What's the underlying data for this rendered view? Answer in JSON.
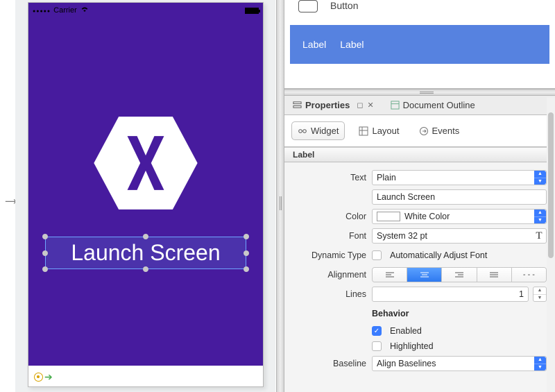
{
  "canvas": {
    "statusbar_carrier": "Carrier",
    "label_text": "Launch Screen"
  },
  "toolbox": {
    "button_label": "Button",
    "label1": "Label",
    "label2": "Label"
  },
  "panel_tabs": {
    "properties": "Properties",
    "outline": "Document Outline"
  },
  "widget_tabs": {
    "widget": "Widget",
    "layout": "Layout",
    "events": "Events"
  },
  "section": {
    "label_header": "Label"
  },
  "form": {
    "text_label": "Text",
    "text_type": "Plain",
    "text_value": "Launch Screen",
    "color_label": "Color",
    "color_value": "White Color",
    "font_label": "Font",
    "font_value": "System 32 pt",
    "dyn_label": "Dynamic Type",
    "dyn_check": "Automatically Adjust Font",
    "align_label": "Alignment",
    "lines_label": "Lines",
    "lines_value": "1",
    "behavior_heading": "Behavior",
    "enabled_label": "Enabled",
    "highlighted_label": "Highlighted",
    "baseline_label": "Baseline",
    "baseline_value": "Align Baselines"
  }
}
